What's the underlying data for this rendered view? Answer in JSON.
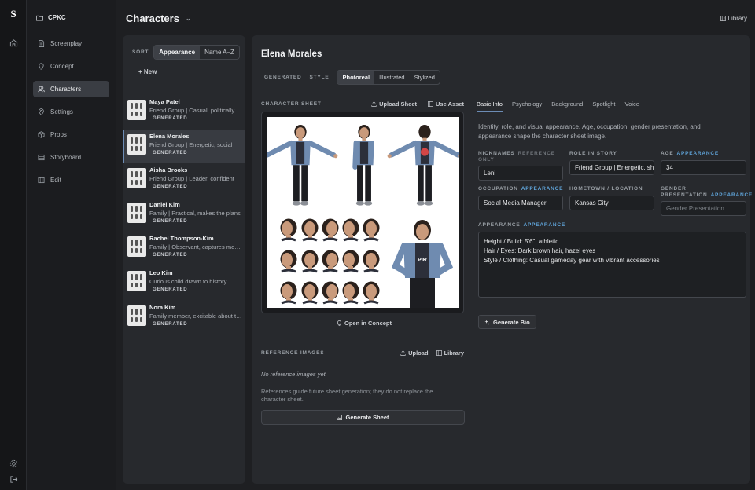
{
  "app": {
    "logo": "S",
    "project": "CPKC"
  },
  "nav": [
    {
      "label": "Screenplay",
      "icon": "document-icon"
    },
    {
      "label": "Concept",
      "icon": "lightbulb-icon"
    },
    {
      "label": "Characters",
      "icon": "users-icon",
      "active": true
    },
    {
      "label": "Settings",
      "icon": "map-pin-icon"
    },
    {
      "label": "Props",
      "icon": "box-icon"
    },
    {
      "label": "Storyboard",
      "icon": "film-icon"
    },
    {
      "label": "Edit",
      "icon": "clapperboard-icon"
    }
  ],
  "header": {
    "title": "Characters",
    "library": "Library"
  },
  "list": {
    "sort_label": "SORT",
    "sort_options": [
      "Appearance",
      "Name A–Z"
    ],
    "sort_selected": "Appearance",
    "new_label": "+ New",
    "characters": [
      {
        "name": "Maya Patel",
        "desc": "Friend Group | Casual, politically aware",
        "badge": "GENERATED"
      },
      {
        "name": "Elena Morales",
        "desc": "Friend Group | Energetic, social",
        "badge": "GENERATED",
        "selected": true
      },
      {
        "name": "Aisha Brooks",
        "desc": "Friend Group | Leader, confident",
        "badge": "GENERATED"
      },
      {
        "name": "Daniel Kim",
        "desc": "Family | Practical, makes the plans",
        "badge": "GENERATED"
      },
      {
        "name": "Rachel Thompson-Kim",
        "desc": "Family | Observant, captures moments",
        "badge": "GENERATED"
      },
      {
        "name": "Leo Kim",
        "desc": "Curious child drawn to history",
        "badge": "GENERATED"
      },
      {
        "name": "Nora Kim",
        "desc": "Family member, excitable about the trip",
        "badge": "GENERATED"
      }
    ]
  },
  "detail": {
    "name": "Elena Morales",
    "generated_label": "GENERATED",
    "style_label": "STYLE",
    "styles": [
      "Photoreal",
      "Illustrated",
      "Stylized"
    ],
    "style_selected": "Photoreal",
    "sheet_label": "CHARACTER SHEET",
    "upload_sheet": "Upload Sheet",
    "use_asset": "Use Asset",
    "open_in_concept": "Open in Concept",
    "refs_label": "REFERENCE IMAGES",
    "refs_upload": "Upload",
    "refs_library": "Library",
    "no_refs": "No reference images yet.",
    "refs_help": "References guide future sheet generation; they do not replace the character sheet.",
    "generate_sheet": "Generate Sheet",
    "sheet_shirt_text": "PIR",
    "colors": {
      "denim": "#6f8bb0",
      "shirt": "#2c2f3a",
      "pants": "#1d1e22",
      "skin": "#c99a7b",
      "hair": "#2b211c",
      "accent": "#d44646"
    }
  },
  "info": {
    "tabs": [
      "Basic Info",
      "Psychology",
      "Background",
      "Spotlight",
      "Voice"
    ],
    "tab_selected": "Basic Info",
    "intro": "Identity, role, and visual appearance. Age, occupation, gender presentation, and appearance shape the character sheet image.",
    "nicknames": {
      "label": "NICKNAMES",
      "tag": "REFERENCE ONLY",
      "value": "Leni"
    },
    "role": {
      "label": "ROLE IN STORY",
      "value": "Friend Group | Energetic, sh"
    },
    "age": {
      "label": "AGE",
      "tag": "APPEARANCE",
      "value": "34"
    },
    "occupation": {
      "label": "OCCUPATION",
      "tag": "APPEARANCE",
      "value": "Social Media Manager"
    },
    "hometown": {
      "label": "HOMETOWN / LOCATION",
      "value": "Kansas City"
    },
    "gender": {
      "label": "GENDER PRESENTATION",
      "tag": "APPEARANCE",
      "placeholder": "Gender Presentation"
    },
    "appearance": {
      "label": "APPEARANCE",
      "tag": "APPEARANCE",
      "lines": [
        "Height / Build: 5'6\", athletic",
        "Hair / Eyes: Dark brown hair, hazel eyes",
        "Style / Clothing: Casual gameday gear with vibrant accessories"
      ]
    },
    "generate_bio": "Generate Bio"
  }
}
